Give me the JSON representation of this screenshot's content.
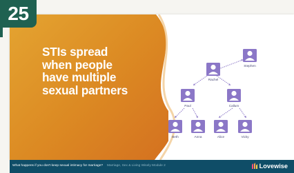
{
  "badge": {
    "number": "25"
  },
  "slide": {
    "headline_lines": [
      "STIs spread",
      "when people",
      "have multiple",
      "sexual partners"
    ],
    "people": {
      "top_left": "Rachel",
      "top_right": "Stephen",
      "mid_left": "Paul",
      "mid_right": "Callum",
      "bottom_1": "Beth",
      "bottom_2": "Anna",
      "bottom_3": "Alice",
      "bottom_4": "Vicky"
    },
    "colors": {
      "accent_orange": "#e49a2c",
      "avatar_purple": "#8b77c7",
      "footer_teal": "#0f4d67",
      "badge_green": "#1f6151"
    }
  },
  "footer": {
    "question": "What happens if you don't keep sexual intimacy for marriage?",
    "course": "Marriage, Sex & Living Wisely Module 2",
    "brand": "Lovewise"
  }
}
